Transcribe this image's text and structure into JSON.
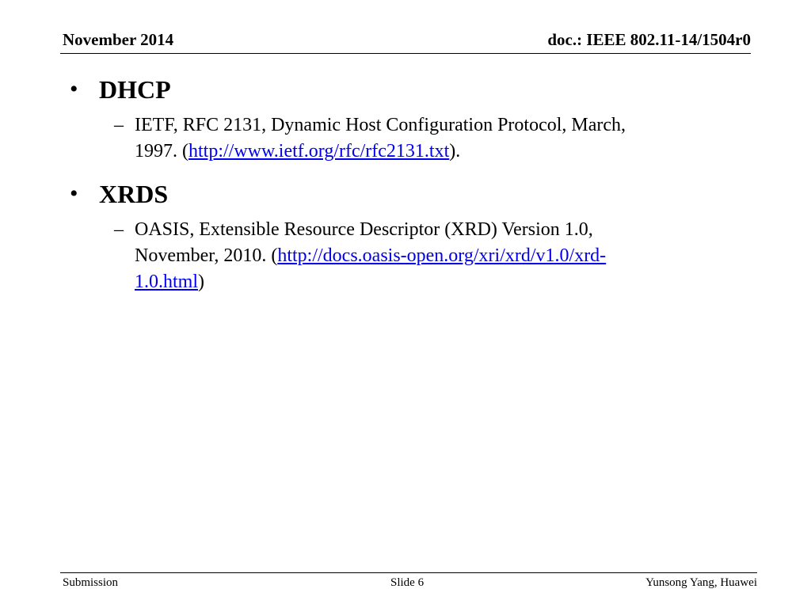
{
  "header": {
    "date": "November 2014",
    "doc_id": "doc.: IEEE 802.11-14/1504r0"
  },
  "bullets": [
    {
      "title": "DHCP",
      "sub": {
        "line1": "IETF, RFC 2131, Dynamic Host Configuration Protocol, March,",
        "line2_prefix": "1997. (",
        "link": "http://www.ietf.org/rfc/rfc2131.txt",
        "line2_suffix": ")."
      }
    },
    {
      "title": "XRDS",
      "sub": {
        "line1": "OASIS, Extensible Resource Descriptor (XRD) Version 1.0,",
        "line2_prefix": "November, 2010. (",
        "link_part1": "http://docs.oasis-open.org/xri/xrd/v1.0/xrd-",
        "link_part2": "1.0.html",
        "line3_suffix": ")"
      }
    }
  ],
  "footer": {
    "left": "Submission",
    "center": "Slide 6",
    "right": "Yunsong Yang, Huawei"
  },
  "glyphs": {
    "bullet": "•",
    "dash": "–"
  },
  "colors": {
    "link": "#0000ee",
    "text": "#000000"
  }
}
